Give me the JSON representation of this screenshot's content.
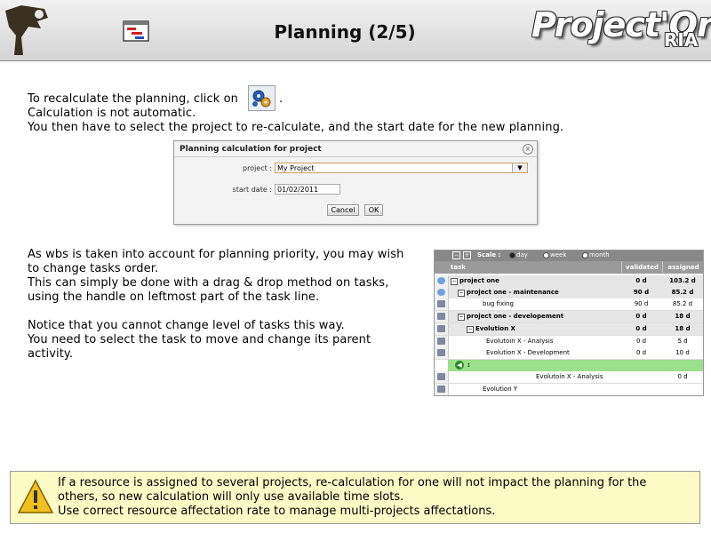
{
  "header": {
    "title": "Planning (2/5)",
    "brand": "Project'Or",
    "brand_sub": "RIA"
  },
  "intro": {
    "line1": "To recalculate the planning, click on",
    "line1_end": ".",
    "line2": "Calculation is not automatic.",
    "line3": "You then have to select the project to re-calculate, and the start date for the new planning."
  },
  "dialog": {
    "title": "Planning calculation for project",
    "project_label": "project :",
    "project_value": "My Project",
    "start_label": "start date :",
    "start_value": "01/02/2011",
    "cancel": "Cancel",
    "ok": "OK"
  },
  "middle": {
    "lines": [
      "As wbs is taken into account for planning priority, you may wish",
      "to change tasks order.",
      "This can simply be done with a drag & drop method on tasks,",
      "using the handle on leftmost part of the task line.",
      "",
      "Notice that you cannot change level of tasks this way.",
      "You need to select the task to move and change its parent",
      "activity."
    ]
  },
  "grid": {
    "scale_label": "Scale :",
    "scale_options": [
      "day",
      "week",
      "month"
    ],
    "columns": [
      "task",
      "validated",
      "assigned"
    ],
    "rows": [
      {
        "name": "project one",
        "validated": "0 d",
        "assigned": "103.2 d"
      },
      {
        "name": "project one - maintenance",
        "validated": "90 d",
        "assigned": "85.2 d"
      },
      {
        "name": "bug fixing",
        "validated": "90 d",
        "assigned": "85.2 d"
      },
      {
        "name": "project one - developement",
        "validated": "0 d",
        "assigned": "18 d"
      },
      {
        "name": "Evolution X",
        "validated": "0 d",
        "assigned": "18 d"
      },
      {
        "name": "Evolutoin X - Analysis",
        "validated": "0 d",
        "assigned": "5 d"
      },
      {
        "name": "Evolution X - Development",
        "validated": "0 d",
        "assigned": "10 d"
      },
      {
        "name": "Evolutoin X - Analysis",
        "validated": "",
        "assigned": "0 d"
      },
      {
        "name": "Evolution Y",
        "validated": "",
        "assigned": ""
      }
    ],
    "drag_marker": ":"
  },
  "tip": {
    "lines": [
      "If a resource is assigned to several projects, re-calculation for one will not impact the planning for the",
      "others, so new calculation will only use available time slots.",
      "Use correct resource affectation rate to manage multi-projects affectations."
    ]
  },
  "icons": [
    "logo-mark-icon",
    "planning-gantt-icon",
    "calculate-planning-icon",
    "warning-icon"
  ]
}
